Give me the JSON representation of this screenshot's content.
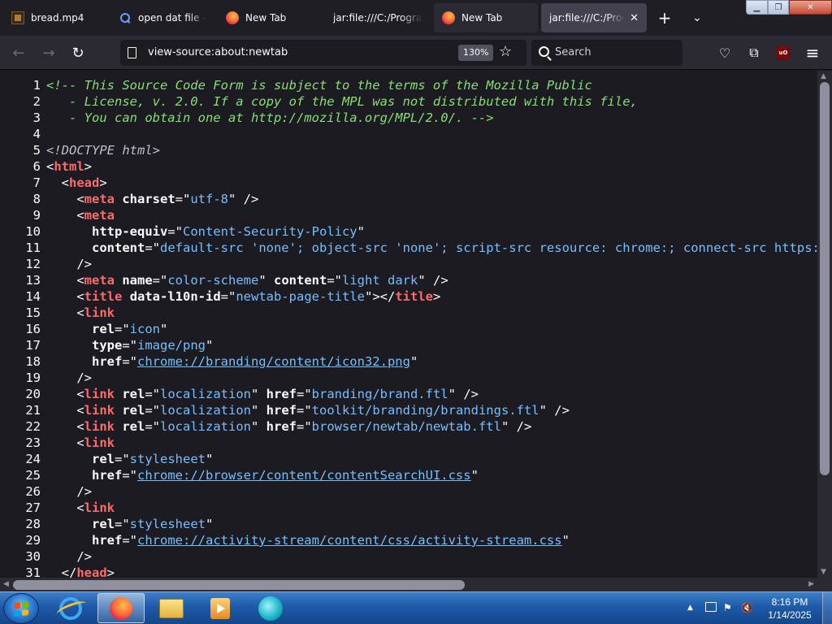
{
  "tabs": [
    {
      "label": "bread.mp4",
      "icon": "film-icon",
      "state": "normal"
    },
    {
      "label": "open dat file - Se",
      "icon": "search-icon",
      "state": "normal"
    },
    {
      "label": "New Tab",
      "icon": "firefox-icon",
      "state": "normal"
    },
    {
      "label": "jar:file:///C:/Program",
      "icon": "none",
      "state": "normal"
    },
    {
      "label": "New Tab",
      "icon": "firefox-icon",
      "state": "hover"
    },
    {
      "label": "jar:file:///C:/Progr",
      "icon": "none",
      "state": "selected"
    }
  ],
  "tab_close_glyph": "✕",
  "new_tab_glyph": "+",
  "tab_list_glyph": "⌄",
  "window_controls": {
    "minimize": "▁",
    "maximize": "❐",
    "close": "✕"
  },
  "nav": {
    "back_glyph": "←",
    "forward_glyph": "→",
    "reload_glyph": "↻",
    "url": "view-source:about:newtab",
    "zoom": "130%",
    "star_glyph": "☆",
    "search_placeholder": "Search",
    "pocket_glyph": "♡",
    "extensions_glyph": "⧉",
    "ublock_label": "uO",
    "menu_glyph": "≡"
  },
  "source_lines": [
    [
      [
        "c",
        "<!-- This Source Code Form is subject to the terms of the Mozilla Public"
      ]
    ],
    [
      [
        "c",
        "   - License, v. 2.0. If a copy of the MPL was not distributed with this file,"
      ]
    ],
    [
      [
        "c",
        "   - You can obtain one at http://mozilla.org/MPL/2.0/. -->"
      ]
    ],
    [],
    [
      [
        "d",
        "<!DOCTYPE html>"
      ]
    ],
    [
      [
        "p",
        "<"
      ],
      [
        "t",
        "html"
      ],
      [
        "p",
        ">"
      ]
    ],
    [
      [
        "p",
        "  <"
      ],
      [
        "t",
        "head"
      ],
      [
        "p",
        ">"
      ]
    ],
    [
      [
        "p",
        "    <"
      ],
      [
        "t",
        "meta"
      ],
      [
        "p",
        " "
      ],
      [
        "a",
        "charset"
      ],
      [
        "p",
        "=\""
      ],
      [
        "v",
        "utf-8"
      ],
      [
        "p",
        "\" />"
      ]
    ],
    [
      [
        "p",
        "    <"
      ],
      [
        "t",
        "meta"
      ]
    ],
    [
      [
        "p",
        "      "
      ],
      [
        "a",
        "http-equiv"
      ],
      [
        "p",
        "=\""
      ],
      [
        "v",
        "Content-Security-Policy"
      ],
      [
        "p",
        "\""
      ]
    ],
    [
      [
        "p",
        "      "
      ],
      [
        "a",
        "content"
      ],
      [
        "p",
        "=\""
      ],
      [
        "v",
        "default-src 'none'; object-src 'none'; script-src resource: chrome:; connect-src https:"
      ]
    ],
    [
      [
        "p",
        "    />"
      ]
    ],
    [
      [
        "p",
        "    <"
      ],
      [
        "t",
        "meta"
      ],
      [
        "p",
        " "
      ],
      [
        "a",
        "name"
      ],
      [
        "p",
        "=\""
      ],
      [
        "v",
        "color-scheme"
      ],
      [
        "p",
        "\" "
      ],
      [
        "a",
        "content"
      ],
      [
        "p",
        "=\""
      ],
      [
        "v",
        "light dark"
      ],
      [
        "p",
        "\" />"
      ]
    ],
    [
      [
        "p",
        "    <"
      ],
      [
        "t",
        "title"
      ],
      [
        "p",
        " "
      ],
      [
        "a",
        "data-l10n-id"
      ],
      [
        "p",
        "=\""
      ],
      [
        "v",
        "newtab-page-title"
      ],
      [
        "p",
        "\"></"
      ],
      [
        "t",
        "title"
      ],
      [
        "p",
        ">"
      ]
    ],
    [
      [
        "p",
        "    <"
      ],
      [
        "t",
        "link"
      ]
    ],
    [
      [
        "p",
        "      "
      ],
      [
        "a",
        "rel"
      ],
      [
        "p",
        "=\""
      ],
      [
        "v",
        "icon"
      ],
      [
        "p",
        "\""
      ]
    ],
    [
      [
        "p",
        "      "
      ],
      [
        "a",
        "type"
      ],
      [
        "p",
        "=\""
      ],
      [
        "v",
        "image/png"
      ],
      [
        "p",
        "\""
      ]
    ],
    [
      [
        "p",
        "      "
      ],
      [
        "a",
        "href"
      ],
      [
        "p",
        "=\""
      ],
      [
        "l",
        "chrome://branding/content/icon32.png"
      ],
      [
        "p",
        "\""
      ]
    ],
    [
      [
        "p",
        "    />"
      ]
    ],
    [
      [
        "p",
        "    <"
      ],
      [
        "t",
        "link"
      ],
      [
        "p",
        " "
      ],
      [
        "a",
        "rel"
      ],
      [
        "p",
        "=\""
      ],
      [
        "v",
        "localization"
      ],
      [
        "p",
        "\" "
      ],
      [
        "a",
        "href"
      ],
      [
        "p",
        "=\""
      ],
      [
        "v",
        "branding/brand.ftl"
      ],
      [
        "p",
        "\" />"
      ]
    ],
    [
      [
        "p",
        "    <"
      ],
      [
        "t",
        "link"
      ],
      [
        "p",
        " "
      ],
      [
        "a",
        "rel"
      ],
      [
        "p",
        "=\""
      ],
      [
        "v",
        "localization"
      ],
      [
        "p",
        "\" "
      ],
      [
        "a",
        "href"
      ],
      [
        "p",
        "=\""
      ],
      [
        "v",
        "toolkit/branding/brandings.ftl"
      ],
      [
        "p",
        "\" />"
      ]
    ],
    [
      [
        "p",
        "    <"
      ],
      [
        "t",
        "link"
      ],
      [
        "p",
        " "
      ],
      [
        "a",
        "rel"
      ],
      [
        "p",
        "=\""
      ],
      [
        "v",
        "localization"
      ],
      [
        "p",
        "\" "
      ],
      [
        "a",
        "href"
      ],
      [
        "p",
        "=\""
      ],
      [
        "v",
        "browser/newtab/newtab.ftl"
      ],
      [
        "p",
        "\" />"
      ]
    ],
    [
      [
        "p",
        "    <"
      ],
      [
        "t",
        "link"
      ]
    ],
    [
      [
        "p",
        "      "
      ],
      [
        "a",
        "rel"
      ],
      [
        "p",
        "=\""
      ],
      [
        "v",
        "stylesheet"
      ],
      [
        "p",
        "\""
      ]
    ],
    [
      [
        "p",
        "      "
      ],
      [
        "a",
        "href"
      ],
      [
        "p",
        "=\""
      ],
      [
        "l",
        "chrome://browser/content/contentSearchUI.css"
      ],
      [
        "p",
        "\""
      ]
    ],
    [
      [
        "p",
        "    />"
      ]
    ],
    [
      [
        "p",
        "    <"
      ],
      [
        "t",
        "link"
      ]
    ],
    [
      [
        "p",
        "      "
      ],
      [
        "a",
        "rel"
      ],
      [
        "p",
        "=\""
      ],
      [
        "v",
        "stylesheet"
      ],
      [
        "p",
        "\""
      ]
    ],
    [
      [
        "p",
        "      "
      ],
      [
        "a",
        "href"
      ],
      [
        "p",
        "=\""
      ],
      [
        "l",
        "chrome://activity-stream/content/css/activity-stream.css"
      ],
      [
        "p",
        "\""
      ]
    ],
    [
      [
        "p",
        "    />"
      ]
    ],
    [
      [
        "p",
        "  </"
      ],
      [
        "t",
        "head"
      ],
      [
        "p",
        ">"
      ]
    ]
  ],
  "taskbar": {
    "apps": [
      {
        "name": "internet-explorer",
        "icon": "ie-icon",
        "active": false
      },
      {
        "name": "firefox",
        "icon": "firefox-icon",
        "active": true
      },
      {
        "name": "file-explorer",
        "icon": "folder-icon",
        "active": false
      },
      {
        "name": "media-player",
        "icon": "media-player-icon",
        "active": false
      },
      {
        "name": "app",
        "icon": "app-icon",
        "active": false
      }
    ],
    "tray": {
      "expand_glyph": "▲",
      "flag_glyph": "⚑",
      "volume_glyph": "🔇"
    },
    "time": "8:16 PM",
    "date": "1/14/2025"
  },
  "colors": {
    "background": "#1c1b22",
    "comment": "#86de74",
    "tag": "#ff6b6b",
    "attribute_value": "#75bfff",
    "taskbar": "#1d5aa8"
  }
}
